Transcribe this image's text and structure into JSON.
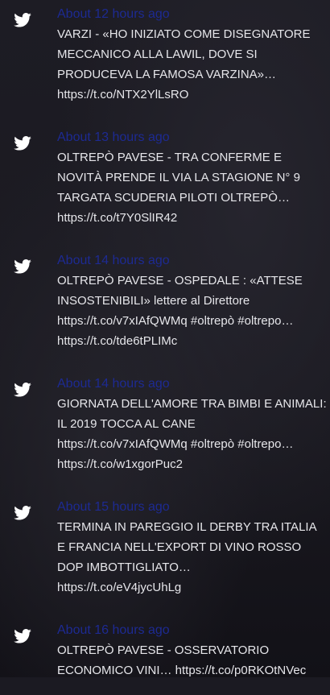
{
  "tweets": [
    {
      "time": "About 12 hours ago",
      "text": "VARZI - «HO INIZIATO COME DISEGNATORE\nMECCANICO ALLA LAWIL, DOVE SI\nPRODUCEVA LA FAMOSA VARZINA»…\nhttps://t.co/NTX2YlLsRO"
    },
    {
      "time": "About 13 hours ago",
      "text": "OLTREPÒ PAVESE - TRA CONFERME E\nNOVITÀ PRENDE IL VIA LA STAGIONE N° 9\nTARGATA SCUDERIA PILOTI OLTREPÒ…\nhttps://t.co/t7Y0SlIR42"
    },
    {
      "time": "About 14 hours ago",
      "text": "OLTREPÒ PAVESE - OSPEDALE : «ATTESE\nINSOSTENIBILI» lettere al Direttore\nhttps://t.co/v7xIAfQWMq #oltrepò #oltrepo…\nhttps://t.co/tde6tPLIMc"
    },
    {
      "time": "About 14 hours ago",
      "text": "GIORNATA DELL'AMORE TRA BIMBI E ANIMALI:\nIL 2019 TOCCA AL CANE\nhttps://t.co/v7xIAfQWMq #oltrepò #oltrepo…\nhttps://t.co/w1xgorPuc2"
    },
    {
      "time": "About 15 hours ago",
      "text": "TERMINA IN PAREGGIO IL DERBY TRA ITALIA\nE FRANCIA NELL'EXPORT DI VINO ROSSO\nDOP IMBOTTIGLIATO…\nhttps://t.co/eV4jycUhLg"
    },
    {
      "time": "About 16 hours ago",
      "text": "OLTREPÒ PAVESE - OSSERVATORIO\nECONOMICO VINI… https://t.co/p0RKOtNVec"
    }
  ],
  "colors": {
    "time": "#1d2a92",
    "text": "#e6e6ea",
    "icon": "#ffffff"
  },
  "icon": "twitter-bird-icon"
}
